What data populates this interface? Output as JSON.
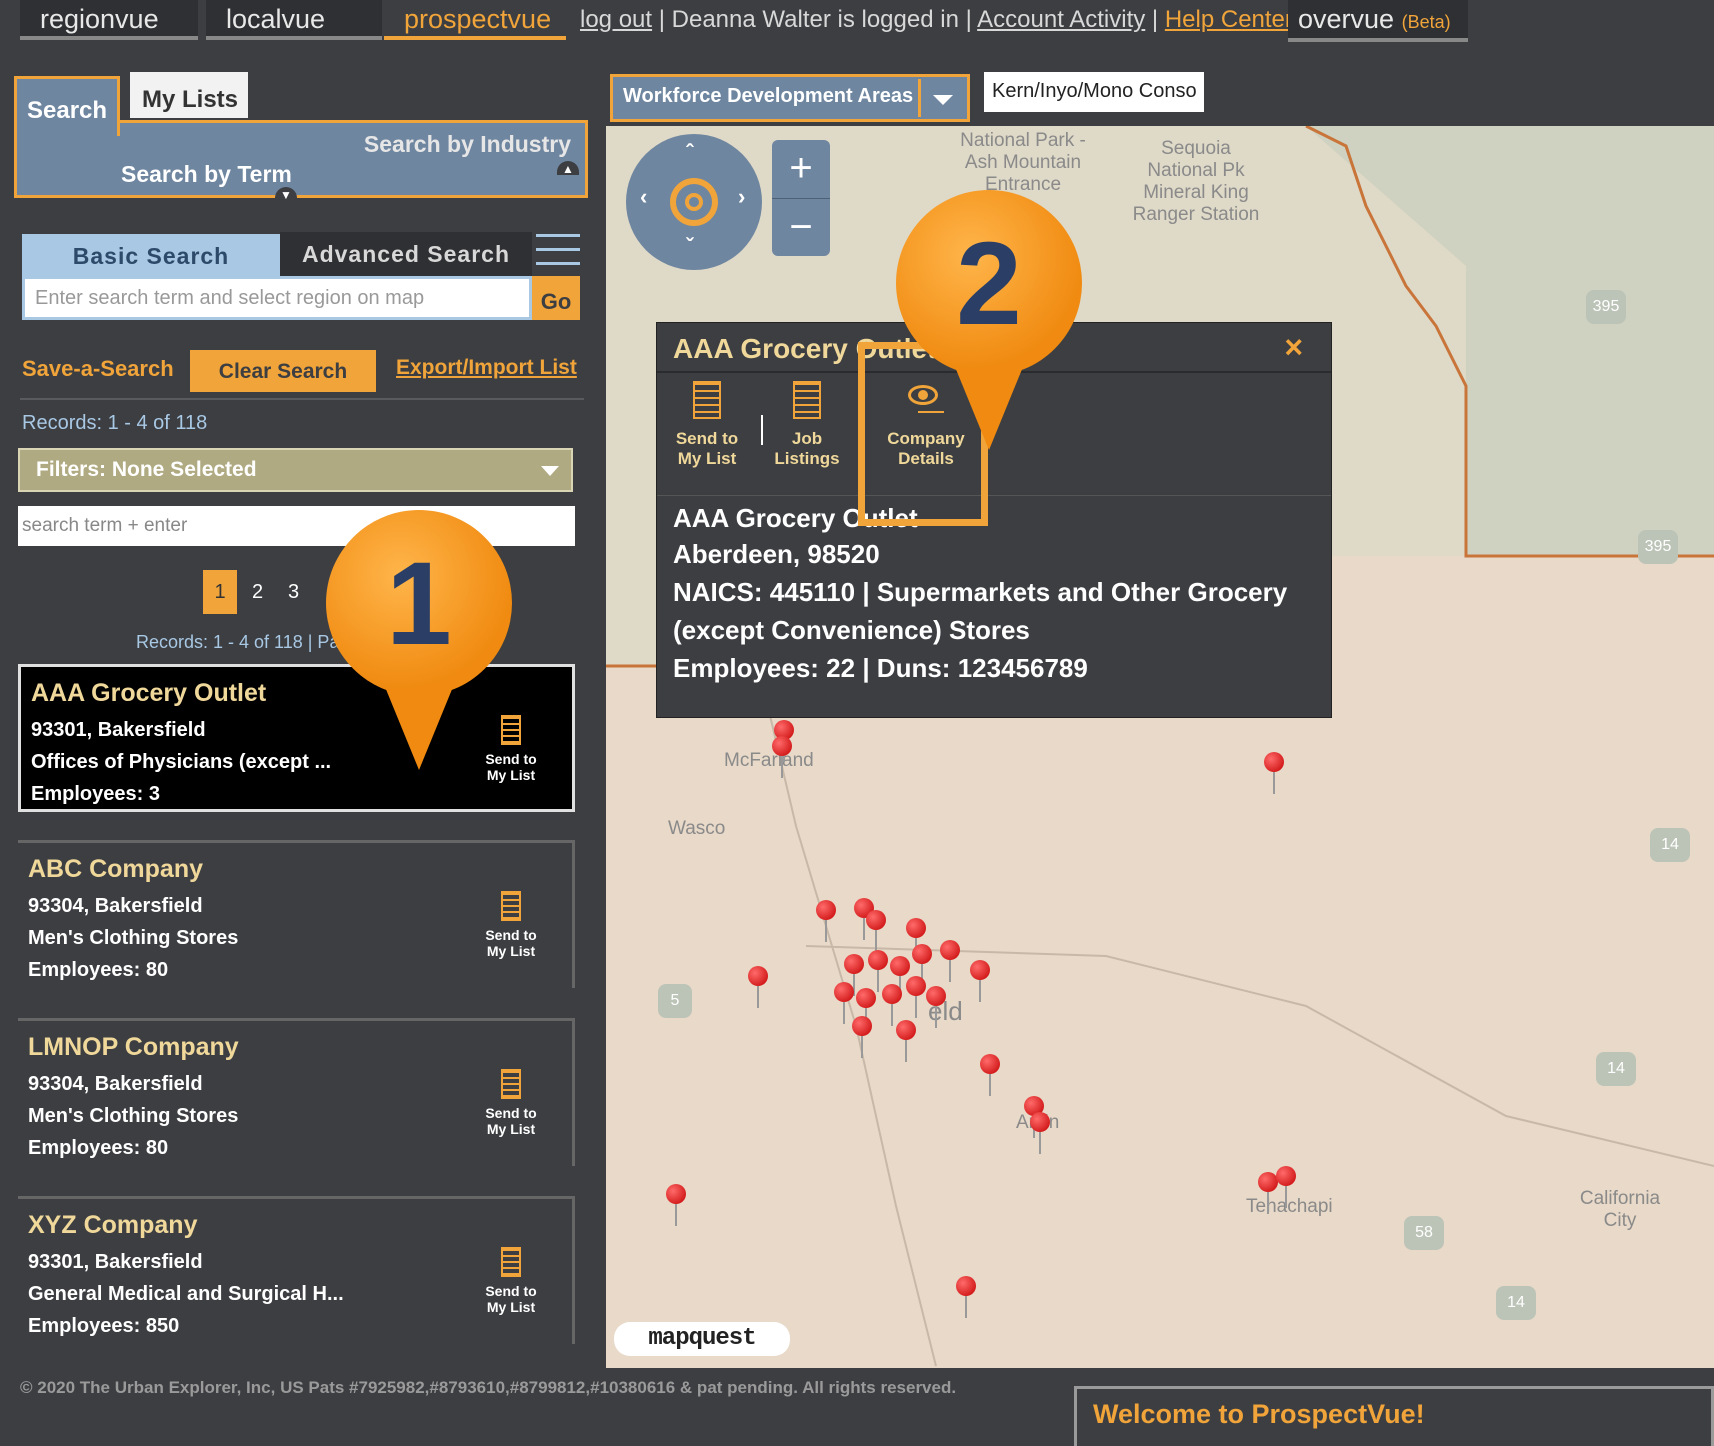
{
  "top_nav": {
    "tabs": [
      "regionvue",
      "localvue",
      "prospectvue"
    ],
    "logout": "log out",
    "logged_in": "Deanna Walter is logged in",
    "account_activity": "Account Activity",
    "help_center": "Help Center",
    "overvue": "overvue",
    "beta": "(Beta)"
  },
  "left": {
    "tab_search": "Search",
    "tab_mylists": "My Lists",
    "search_by_industry": "Search by Industry",
    "search_by_term": "Search by Term",
    "basic_search": "Basic Search",
    "advanced_search": "Advanced Search",
    "search_placeholder": "Enter search term and select region on map",
    "go": "Go",
    "save_a_search": "Save-a-Search",
    "clear_search": "Clear Search",
    "export_import": "Export/Import List",
    "records": "Records: 1 - 4 of 118",
    "filters": "Filters: None Selected",
    "filter_placeholder": "search term + enter",
    "pages": [
      "1",
      "2",
      "3"
    ],
    "records_page": "Records: 1 - 4 of 118 | Pag",
    "send_to_my_list_1": "Send to",
    "send_to_my_list_2": "My List",
    "results": [
      {
        "name": "AAA Grocery Outlet",
        "address": "93301, Bakersfield",
        "industry": "Offices of Physicians (except ...",
        "employees": "Employees: 3"
      },
      {
        "name": "ABC Company",
        "address": "93304, Bakersfield",
        "industry": "Men's Clothing Stores",
        "employees": "Employees: 80"
      },
      {
        "name": "LMNOP Company",
        "address": "93304, Bakersfield",
        "industry": "Men's Clothing Stores",
        "employees": "Employees: 80"
      },
      {
        "name": "XYZ Company",
        "address": "93301, Bakersfield",
        "industry": "General Medical and Surgical H...",
        "employees": "Employees: 850"
      }
    ]
  },
  "map": {
    "wda_label": "Workforce Development Areas",
    "region_value": "Kern/Inyo/Mono Conso",
    "zoom_in": "+",
    "zoom_out": "−",
    "labels": [
      "National Park - Ash Mountain Entrance",
      "Sequoia National Pk Mineral King Ranger Station",
      "McFarland",
      "Wasco",
      "Arvin",
      "Tehachapi",
      "California City",
      "eld"
    ],
    "shields": [
      "395",
      "395",
      "14",
      "14",
      "14",
      "5",
      "58"
    ],
    "mapquest": "mapquest"
  },
  "popup": {
    "title": "AAA Grocery Outlet",
    "close": "×",
    "btn_send_1": "Send to",
    "btn_send_2": "My List",
    "btn_jobs_1": "Job",
    "btn_jobs_2": "Listings",
    "btn_details_1": "Company",
    "btn_details_2": "Details",
    "name": "AAA Grocery Outlet",
    "city": "Aberdeen, 98520",
    "naics_1": "NAICS: 445110 | Supermarkets and Other Grocery",
    "naics_2": "(except Convenience) Stores",
    "employees": "Employees: 22 | Duns:  123456789"
  },
  "markers": [
    "1",
    "2"
  ],
  "footer": "© 2020 The Urban Explorer, Inc, US Pats #7925982,#8793610,#8799812,#10380616 & pat pending. All rights reserved.",
  "welcome": "Welcome to ProspectVue!",
  "colors": {
    "accent": "#f0a43a",
    "panel": "#3c3e42",
    "blue": "#6f86a0",
    "pin": "#c40000"
  }
}
